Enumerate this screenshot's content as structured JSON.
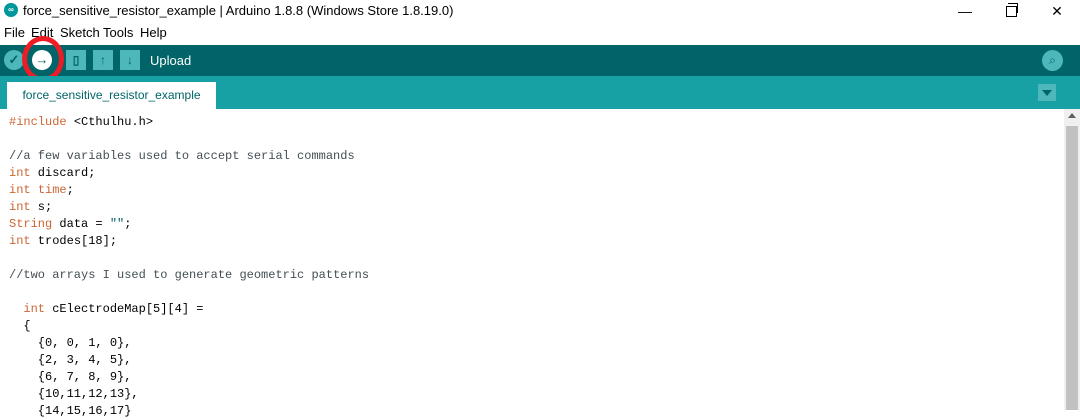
{
  "window": {
    "title": "force_sensitive_resistor_example | Arduino 1.8.8 (Windows Store 1.8.19.0)",
    "icon": "arduino-logo-icon",
    "controls": {
      "minimize": "—",
      "close": "✕"
    }
  },
  "menu": {
    "items": [
      "File",
      "Edit",
      "Sketch",
      "Tools",
      "Help"
    ]
  },
  "toolbar": {
    "verify_glyph": "✓",
    "upload_glyph": "→",
    "new_glyph": "▯",
    "open_glyph": "↑",
    "save_glyph": "↓",
    "hover_label": "Upload",
    "serial_glyph": "⌕",
    "colors": {
      "bar": "#006468",
      "button": "#4db7bb",
      "highlight": "#ee1c24"
    }
  },
  "tabs": [
    {
      "label": "force_sensitive_resistor_example",
      "active": true
    }
  ],
  "editor": {
    "lines": [
      {
        "parts": [
          {
            "t": "#include ",
            "c": "tp"
          },
          {
            "t": "<Cthulhu.h>",
            "c": ""
          }
        ]
      },
      {
        "parts": []
      },
      {
        "parts": [
          {
            "t": "//a few variables used to accept serial commands",
            "c": "cm"
          }
        ]
      },
      {
        "parts": [
          {
            "t": "int",
            "c": "tp"
          },
          {
            "t": " discard;",
            "c": ""
          }
        ]
      },
      {
        "parts": [
          {
            "t": "int",
            "c": "tp"
          },
          {
            "t": " ",
            "c": ""
          },
          {
            "t": "time",
            "c": "tp"
          },
          {
            "t": ";",
            "c": ""
          }
        ]
      },
      {
        "parts": [
          {
            "t": "int",
            "c": "tp"
          },
          {
            "t": " s;",
            "c": ""
          }
        ]
      },
      {
        "parts": [
          {
            "t": "String",
            "c": "tp"
          },
          {
            "t": " data = ",
            "c": ""
          },
          {
            "t": "\"\"",
            "c": "st"
          },
          {
            "t": ";",
            "c": ""
          }
        ]
      },
      {
        "parts": [
          {
            "t": "int",
            "c": "tp"
          },
          {
            "t": " trodes[18];",
            "c": ""
          }
        ]
      },
      {
        "parts": []
      },
      {
        "parts": [
          {
            "t": "//two arrays I used to generate geometric patterns",
            "c": "cm"
          }
        ]
      },
      {
        "parts": []
      },
      {
        "parts": [
          {
            "t": "  ",
            "c": ""
          },
          {
            "t": "int",
            "c": "tp"
          },
          {
            "t": " cElectrodeMap[5][4] =",
            "c": ""
          }
        ]
      },
      {
        "parts": [
          {
            "t": "  {",
            "c": ""
          }
        ]
      },
      {
        "parts": [
          {
            "t": "    {0, 0, 1, 0},",
            "c": ""
          }
        ]
      },
      {
        "parts": [
          {
            "t": "    {2, 3, 4, 5},",
            "c": ""
          }
        ]
      },
      {
        "parts": [
          {
            "t": "    {6, 7, 8, 9},",
            "c": ""
          }
        ]
      },
      {
        "parts": [
          {
            "t": "    {10,11,12,13},",
            "c": ""
          }
        ]
      },
      {
        "parts": [
          {
            "t": "    {14,15,16,17}",
            "c": ""
          }
        ]
      }
    ]
  }
}
